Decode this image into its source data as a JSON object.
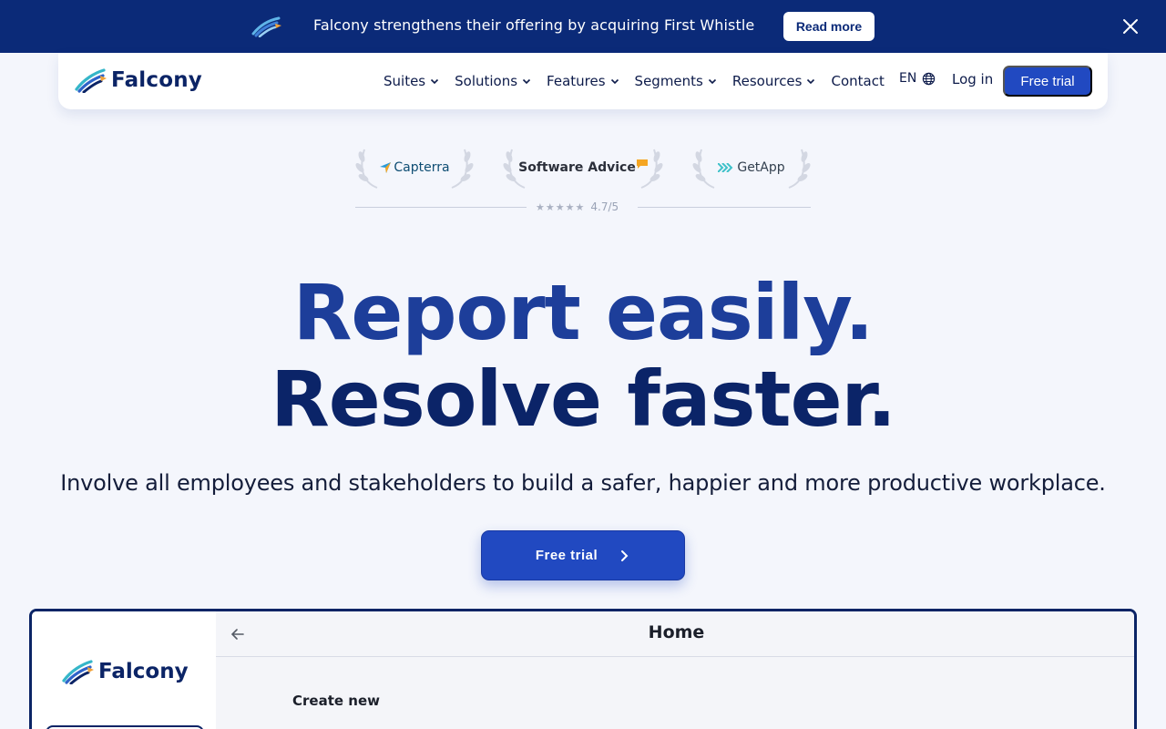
{
  "announcement": {
    "message": "Falcony strengthens their offering by acquiring First Whistle",
    "button": "Read more",
    "icons": [
      "falcony-bird-icon",
      "close-icon"
    ]
  },
  "nav": {
    "brand": "Falcony",
    "menu": [
      {
        "label": "Suites",
        "dropdown": true
      },
      {
        "label": "Solutions",
        "dropdown": true
      },
      {
        "label": "Features",
        "dropdown": true
      },
      {
        "label": "Segments",
        "dropdown": true
      },
      {
        "label": "Resources",
        "dropdown": true
      },
      {
        "label": "Contact",
        "dropdown": false
      }
    ],
    "language": "EN",
    "login": "Log in",
    "trial": "Free trial"
  },
  "reviews": {
    "badges": [
      "Capterra",
      "Software Advice",
      "GetApp"
    ],
    "score": "4.7/5",
    "stars": 5
  },
  "hero": {
    "line1": "Report easily.",
    "line2": "Resolve faster.",
    "subtitle": "Involve all employees and stakeholders to build a safer, happier and more productive workplace.",
    "cta": "Free trial"
  },
  "preview": {
    "brand": "Falcony",
    "page_title": "Home",
    "section": "Create new"
  },
  "colors": {
    "brand_navy": "#0b2a78",
    "primary_blue": "#2149c1",
    "background": "#f4f6fc"
  }
}
